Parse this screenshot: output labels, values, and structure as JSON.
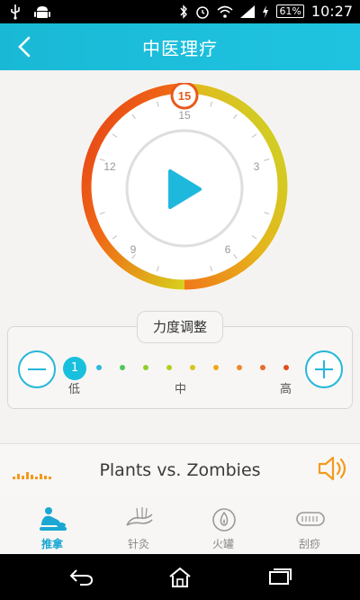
{
  "status_bar": {
    "time": "10:27",
    "battery": "61%",
    "icons": [
      "usb-icon",
      "android-icon",
      "bluetooth-icon",
      "alarm-icon",
      "wifi-icon",
      "signal-icon",
      "charging-icon",
      "battery-icon"
    ]
  },
  "header": {
    "title": "中医理疗",
    "back_icon": "back-arrow-icon"
  },
  "timer": {
    "value": "15",
    "ticks": [
      "15",
      "3",
      "6",
      "9",
      "12"
    ],
    "play_icon": "play-icon",
    "colors": {
      "start": "#e85a1c",
      "end": "#d8d21e",
      "face": "#ffffff",
      "ring": "#e0e0e0",
      "play": "#1fb8dd"
    }
  },
  "strength": {
    "title": "力度调整",
    "current": "1",
    "level_count": 10,
    "labels": {
      "low": "低",
      "mid": "中",
      "high": "高"
    },
    "minus_icon": "minus-icon",
    "plus_icon": "plus-icon",
    "dot_colors": [
      "#19c0dd",
      "#2bb8e0",
      "#4fc85a",
      "#8fcf2d",
      "#b9cc1e",
      "#d8c41e",
      "#f0aa20",
      "#ee8a2a",
      "#e86a2a",
      "#e34a22"
    ]
  },
  "music": {
    "song": "Plants vs. Zombies",
    "eq_icon": "equalizer-icon",
    "speaker_icon": "speaker-icon"
  },
  "tabs": [
    {
      "label": "推拿",
      "icon": "massage-icon",
      "active": true
    },
    {
      "label": "针灸",
      "icon": "acupuncture-icon",
      "active": false
    },
    {
      "label": "火罐",
      "icon": "fire-cupping-icon",
      "active": false
    },
    {
      "label": "刮痧",
      "icon": "scraping-icon",
      "active": false
    }
  ],
  "nav": [
    "back-nav-icon",
    "home-nav-icon",
    "recent-apps-icon"
  ]
}
